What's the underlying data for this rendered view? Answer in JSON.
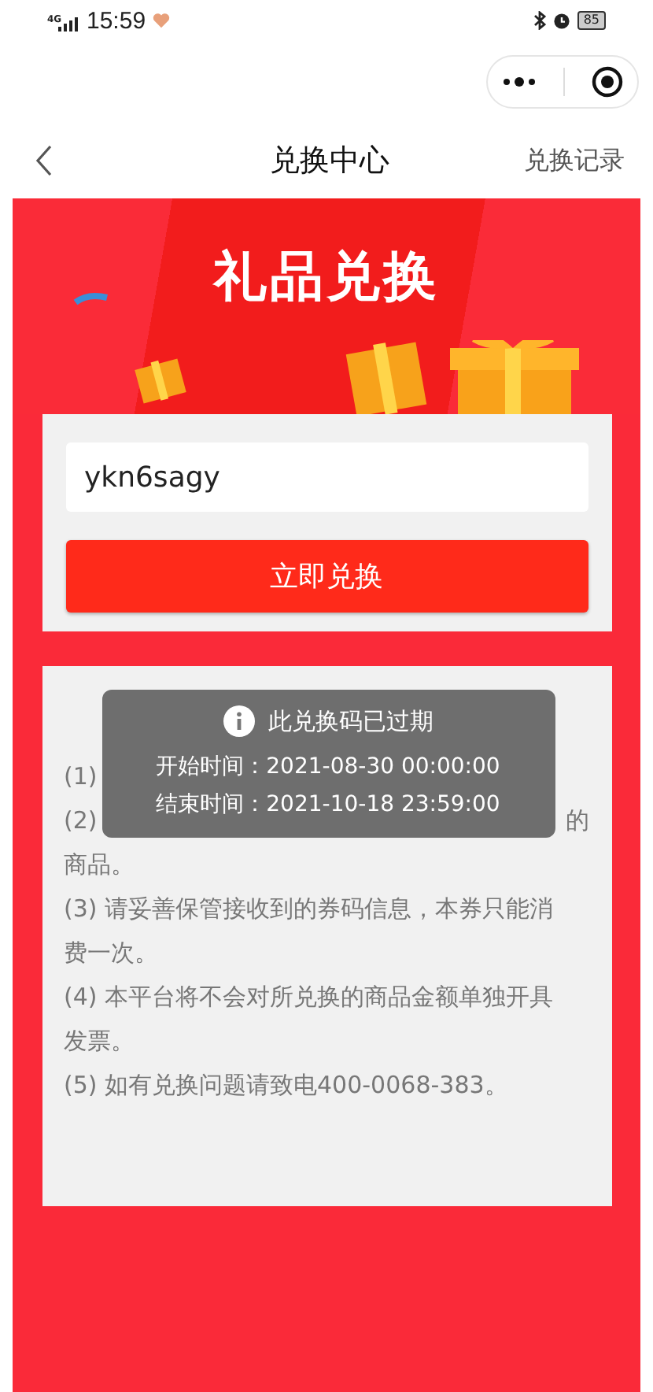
{
  "status_bar": {
    "network": "4G",
    "time": "15:59",
    "battery": "85"
  },
  "nav": {
    "title": "兑换中心",
    "action": "兑换记录"
  },
  "banner": {
    "title": "礼品兑换"
  },
  "redeem": {
    "value": "ykn6sagy",
    "button": "立即兑换"
  },
  "instructions": {
    "lines": [
      [
        "(1)"
      ],
      [
        "(2)",
        "的"
      ],
      [
        "商品。"
      ],
      [
        "(3) 请妥善保管接收到的券码信息，本券只能消"
      ],
      [
        "费一次。"
      ],
      [
        "(4) 本平台将不会对所兑换的商品金额单独开具"
      ],
      [
        "发票。"
      ],
      [
        "(5) 如有兑换问题请致电400-0068-383。"
      ]
    ]
  },
  "toast": {
    "message": "此兑换码已过期",
    "lines": [
      "开始时间：2021-08-30 00:00:00",
      "结束时间：2021-10-18 23:59:00"
    ]
  }
}
